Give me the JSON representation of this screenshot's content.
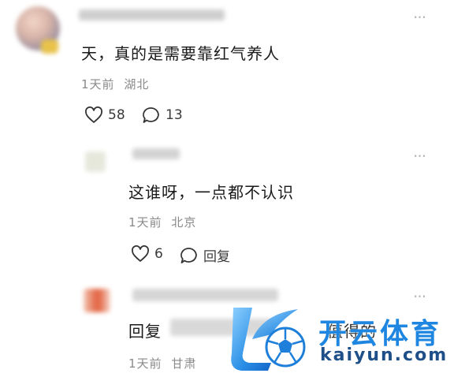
{
  "comments": [
    {
      "text": "天，真的是需要靠红气养人",
      "time": "1天前",
      "location": "湖北",
      "likes": "58",
      "replies": "13"
    },
    {
      "text": "这谁呀，一点都不认识",
      "time": "1天前",
      "location": "北京",
      "likes": "6",
      "reply_label": "回复"
    },
    {
      "text_prefix": "回复",
      "text_suffix": "值得的",
      "time": "1天前",
      "location": "甘肃"
    }
  ],
  "watermark": {
    "brand_cn": "开云体育",
    "brand_url": "kaiyun.com",
    "brand_color": "#1e86e0"
  },
  "more_menu_glyph": "···"
}
